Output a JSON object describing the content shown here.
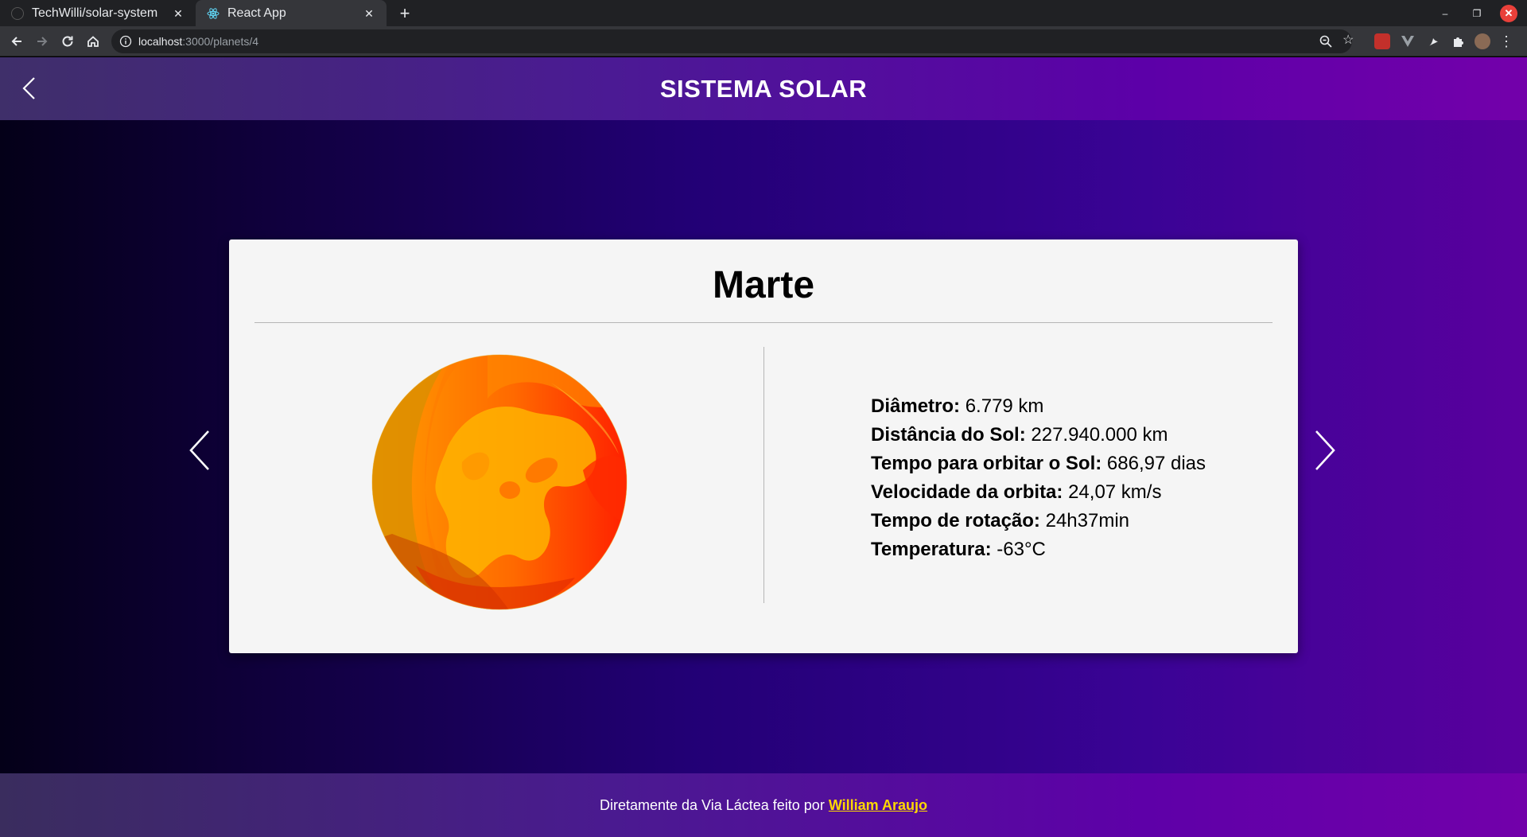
{
  "browser": {
    "tabs": [
      {
        "title": "TechWilli/solar-system",
        "active": false,
        "icon": "github-icon"
      },
      {
        "title": "React App",
        "active": true,
        "icon": "react-icon"
      }
    ],
    "url_host": "localhost",
    "url_path": ":3000/planets/4"
  },
  "header": {
    "title": "SISTEMA SOLAR"
  },
  "planet": {
    "name": "Marte",
    "facts": [
      {
        "label": "Diâmetro:",
        "value": "6.779 km"
      },
      {
        "label": "Distância do Sol:",
        "value": "227.940.000 km"
      },
      {
        "label": "Tempo para orbitar o Sol:",
        "value": "686,97 dias"
      },
      {
        "label": "Velocidade da orbita:",
        "value": "24,07 km/s"
      },
      {
        "label": "Tempo de rotação:",
        "value": "24h37min"
      },
      {
        "label": "Temperatura:",
        "value": "-63°C"
      }
    ]
  },
  "footer": {
    "text": "Diretamente da Via Láctea feito por",
    "author": "William Araujo"
  },
  "colors": {
    "accent": "#5c00a8",
    "footer_link": "#ffd800"
  }
}
